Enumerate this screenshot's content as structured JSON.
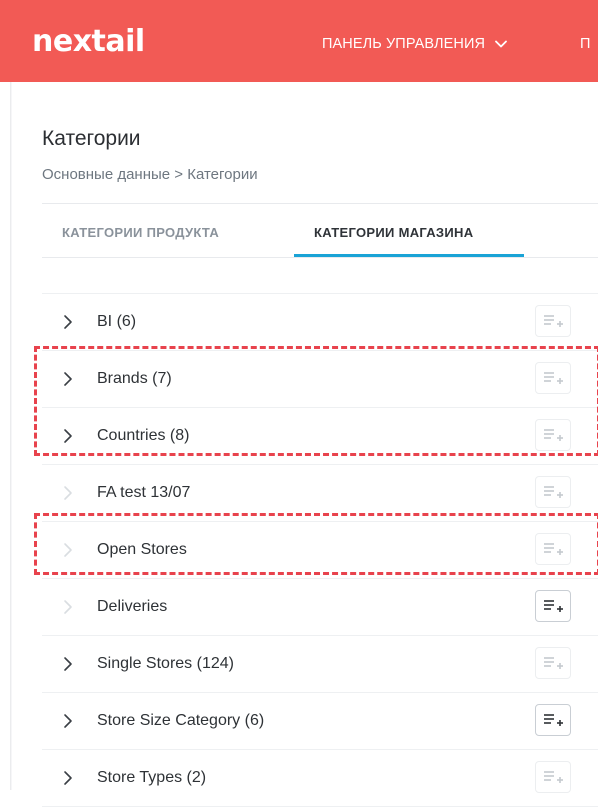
{
  "header": {
    "logo_text": "nextail",
    "nav": [
      {
        "label": "ПАНЕЛЬ УПРАВЛЕНИЯ"
      },
      {
        "label": "П"
      }
    ],
    "background_color": "#f25a55"
  },
  "page": {
    "title": "Категории",
    "breadcrumb": "Основные данные > Категории"
  },
  "tabs": [
    {
      "label": "КАТЕГОРИИ ПРОДУКТА",
      "active": false
    },
    {
      "label": "КАТЕГОРИИ МАГАЗИНА",
      "active": true
    }
  ],
  "accent_color": "#1aa3d6",
  "highlight_color": "#e8434d",
  "categories": [
    {
      "label": "BI (6)",
      "expandable": true,
      "add_enabled": false
    },
    {
      "label": "Brands (7)",
      "expandable": true,
      "add_enabled": false
    },
    {
      "label": "Countries (8)",
      "expandable": true,
      "add_enabled": false
    },
    {
      "label": "FA test 13/07",
      "expandable": false,
      "add_enabled": false
    },
    {
      "label": "Open Stores",
      "expandable": false,
      "add_enabled": false
    },
    {
      "label": "Deliveries",
      "expandable": false,
      "add_enabled": true
    },
    {
      "label": "Single Stores (124)",
      "expandable": true,
      "add_enabled": false
    },
    {
      "label": "Store Size Category (6)",
      "expandable": true,
      "add_enabled": true
    },
    {
      "label": "Store Types (2)",
      "expandable": true,
      "add_enabled": false
    }
  ],
  "icons": {
    "row_toggle": "chevron-right-icon",
    "row_add": "add-to-list-icon",
    "nav_dropdown": "chevron-down-icon"
  }
}
